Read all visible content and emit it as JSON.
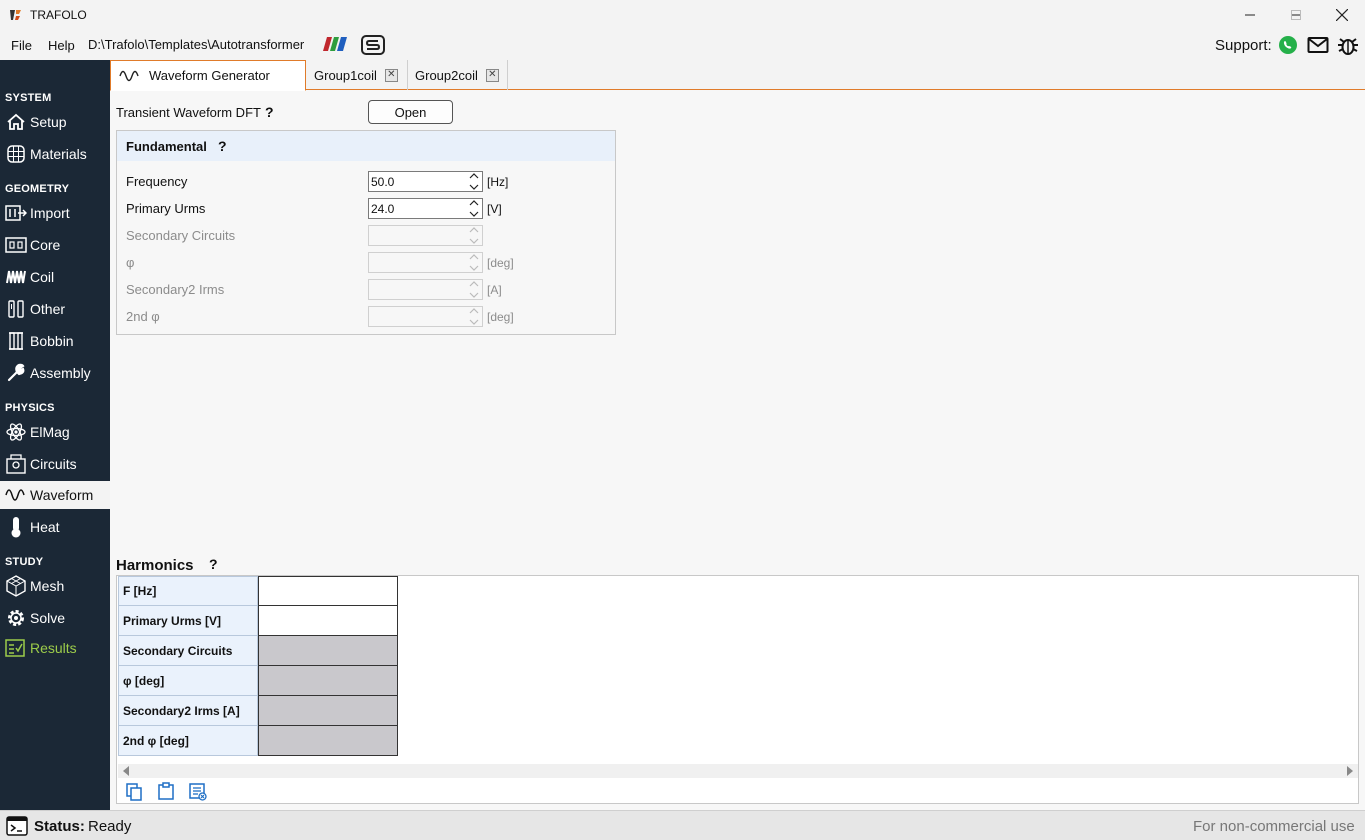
{
  "window": {
    "title": "TRAFOLO"
  },
  "menu": {
    "file": "File",
    "help": "Help",
    "path": "D:\\Trafolo\\Templates\\Autotransformer",
    "support_label": "Support:"
  },
  "sidebar": {
    "sections": [
      "SYSTEM",
      "GEOMETRY",
      "PHYSICS",
      "STUDY"
    ],
    "items": [
      {
        "label": "Setup"
      },
      {
        "label": "Materials"
      },
      {
        "label": "Import"
      },
      {
        "label": "Core"
      },
      {
        "label": "Coil"
      },
      {
        "label": "Other"
      },
      {
        "label": "Bobbin"
      },
      {
        "label": "Assembly"
      },
      {
        "label": "ElMag"
      },
      {
        "label": "Circuits"
      },
      {
        "label": "Waveform"
      },
      {
        "label": "Heat"
      },
      {
        "label": "Mesh"
      },
      {
        "label": "Solve"
      },
      {
        "label": "Results"
      }
    ]
  },
  "tabs": [
    {
      "label": "Waveform Generator"
    },
    {
      "label": "Group1coil"
    },
    {
      "label": "Group2coil"
    }
  ],
  "dft": {
    "label": "Transient Waveform DFT",
    "help": "?",
    "button": "Open"
  },
  "fundamental": {
    "title": "Fundamental",
    "help": "?",
    "rows": [
      {
        "label": "Frequency",
        "value": "50.0",
        "unit": "[Hz]"
      },
      {
        "label": "Primary Urms",
        "value": "24.0",
        "unit": "[V]"
      },
      {
        "label": "Secondary Circuits",
        "value": "",
        "unit": ""
      },
      {
        "label": "φ",
        "value": "",
        "unit": "[deg]"
      },
      {
        "label": "Secondary2 Irms",
        "value": "",
        "unit": "[A]"
      },
      {
        "label": "2nd φ",
        "value": "",
        "unit": "[deg]"
      }
    ]
  },
  "harmonics": {
    "title": "Harmonics",
    "help": "?",
    "rows": [
      {
        "label": "F [Hz]"
      },
      {
        "label": "Primary Urms [V]"
      },
      {
        "label": "Secondary Circuits"
      },
      {
        "label": "φ [deg]"
      },
      {
        "label": "Secondary2 Irms [A]"
      },
      {
        "label": "2nd φ [deg]"
      }
    ]
  },
  "status": {
    "label": "Status:",
    "value": "Ready",
    "license": "For non-commercial use"
  },
  "colors": {
    "sidebar_bg": "#1b2836",
    "accent": "#e07b2a",
    "results_green": "#9ccc4a"
  }
}
